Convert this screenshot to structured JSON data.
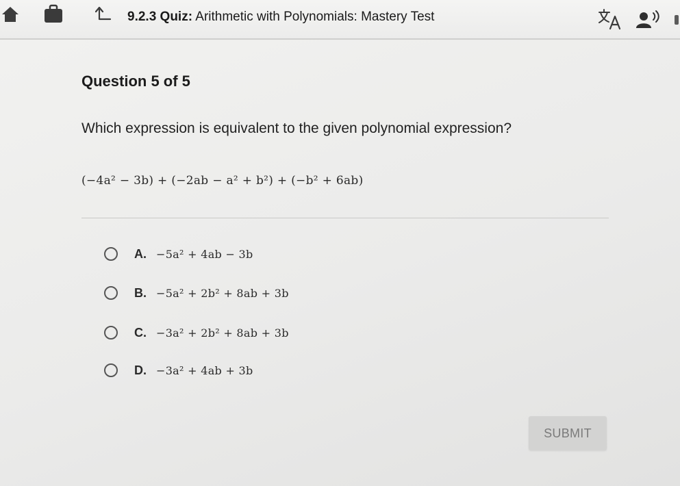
{
  "header": {
    "quiz_code": "9.2.3",
    "quiz_kind": "Quiz:",
    "quiz_title": "Arithmetic with Polynomials: Mastery Test",
    "icons": [
      "home-icon",
      "backpack-icon",
      "up-arrow-icon",
      "translate-icon",
      "audio-icon"
    ]
  },
  "question": {
    "number_label": "Question 5 of 5",
    "prompt": "Which expression is equivalent to the given polynomial expression?",
    "expression": "(−4a² − 3b) + (−2ab − a² + b²) + (−b² + 6ab)"
  },
  "options": [
    {
      "letter": "A.",
      "text": "−5a² + 4ab − 3b"
    },
    {
      "letter": "B.",
      "text": "−5a² + 2b² + 8ab + 3b"
    },
    {
      "letter": "C.",
      "text": "−3a² + 2b² + 8ab + 3b"
    },
    {
      "letter": "D.",
      "text": "−3a² + 4ab + 3b"
    }
  ],
  "submit": {
    "label": "SUBMIT"
  },
  "colors": {
    "background": "#ebebea",
    "text": "#1a1a1a",
    "submit_bg": "#d3d3d2",
    "submit_text": "#7a7a7a"
  }
}
